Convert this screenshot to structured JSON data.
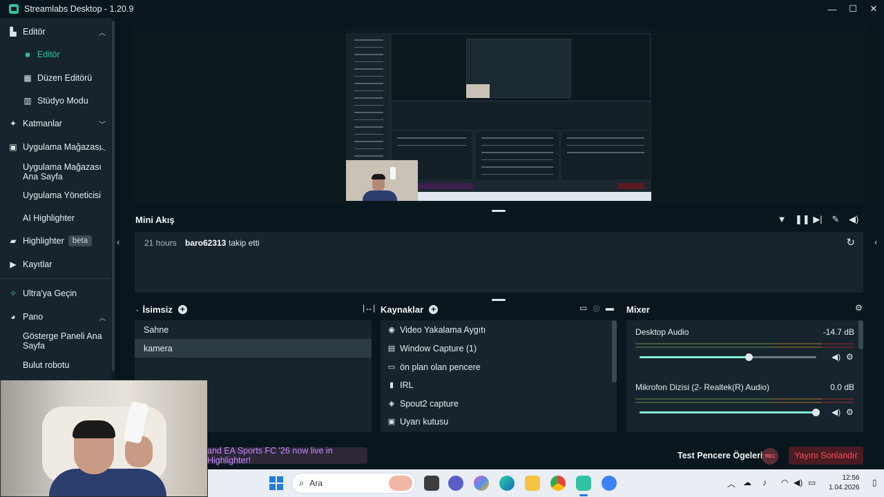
{
  "window": {
    "title": "Streamlabs Desktop - 1.20.9",
    "minimize": "—",
    "maximize": "☐",
    "close": "✕"
  },
  "sidebar": {
    "items": [
      {
        "label": "Editör",
        "icon": "editor-icon",
        "type": "section",
        "chevron": "up"
      },
      {
        "label": "Editör",
        "icon": "video-camera-icon",
        "type": "sub",
        "active": true
      },
      {
        "label": "Düzen Editörü",
        "icon": "layout-grid-icon",
        "type": "sub"
      },
      {
        "label": "Stüdyo Modu",
        "icon": "columns-icon",
        "type": "sub"
      },
      {
        "label": "Katmanlar",
        "icon": "magic-icon",
        "type": "section",
        "chevron": "down"
      },
      {
        "label": "Uygulama Mağazası",
        "icon": "store-icon",
        "type": "section",
        "chevron": "up"
      },
      {
        "label": "Uygulama Mağazası Ana Sayfa",
        "type": "sub"
      },
      {
        "label": "Uygulama Yöneticisi",
        "type": "sub"
      },
      {
        "label": "AI Highlighter",
        "type": "sub"
      },
      {
        "label": "Highlighter",
        "icon": "film-icon",
        "type": "section",
        "badge": "beta"
      },
      {
        "label": "Kayıtlar",
        "icon": "play-circle-icon",
        "type": "section"
      },
      {
        "label": "Ultra'ya Geçin",
        "icon": "ultra-icon",
        "type": "section"
      },
      {
        "label": "Pano",
        "icon": "palette-icon",
        "type": "section",
        "chevron": "up"
      },
      {
        "label": "Gösterge Paneli Ana Sayfa",
        "type": "sub"
      },
      {
        "label": "Bulut robotu",
        "type": "sub"
      }
    ]
  },
  "feed": {
    "title": "Mini Akış",
    "time": "21 hours",
    "user": "baro62313",
    "action": "takip etti"
  },
  "scenes": {
    "title": "İsimsiz",
    "items": [
      "Sahne",
      "kamera"
    ],
    "selected": 1
  },
  "sources": {
    "title": "Kaynaklar",
    "items": [
      {
        "label": "Video Yakalama Aygıtı",
        "icon": "webcam-icon"
      },
      {
        "label": "Window Capture (1)",
        "icon": "window-icon"
      },
      {
        "label": "ön plan olan pencere",
        "icon": "monitor-icon"
      },
      {
        "label": "IRL",
        "icon": "file-icon"
      },
      {
        "label": "Spout2 capture",
        "icon": "shield-icon"
      },
      {
        "label": "Uyarı kutusu",
        "icon": "alert-box-icon"
      }
    ]
  },
  "mixer": {
    "title": "Mixer",
    "channels": [
      {
        "name": "Desktop Audio",
        "db": "-14.7 dB",
        "level": 0.62
      },
      {
        "name": "Mikrofon Dizisi (2- Realtek(R) Audio)",
        "db": "0.0 dB",
        "level": 1.0
      }
    ]
  },
  "footer": {
    "promo": "and EA Sports FC '26 now live in Highlighter!",
    "test_widgets": "Test Pencere Ögeleri",
    "rec": "REC",
    "end_stream": "Yayını Sonlandır"
  },
  "taskbar": {
    "search_placeholder": "Ara",
    "time": "12:56",
    "date": "1.04.2026"
  },
  "colors": {
    "accent": "#31c3a2",
    "slider": "#80f5d2",
    "end_button_text": "#ff4b5c",
    "promo_text": "#c489ff"
  }
}
